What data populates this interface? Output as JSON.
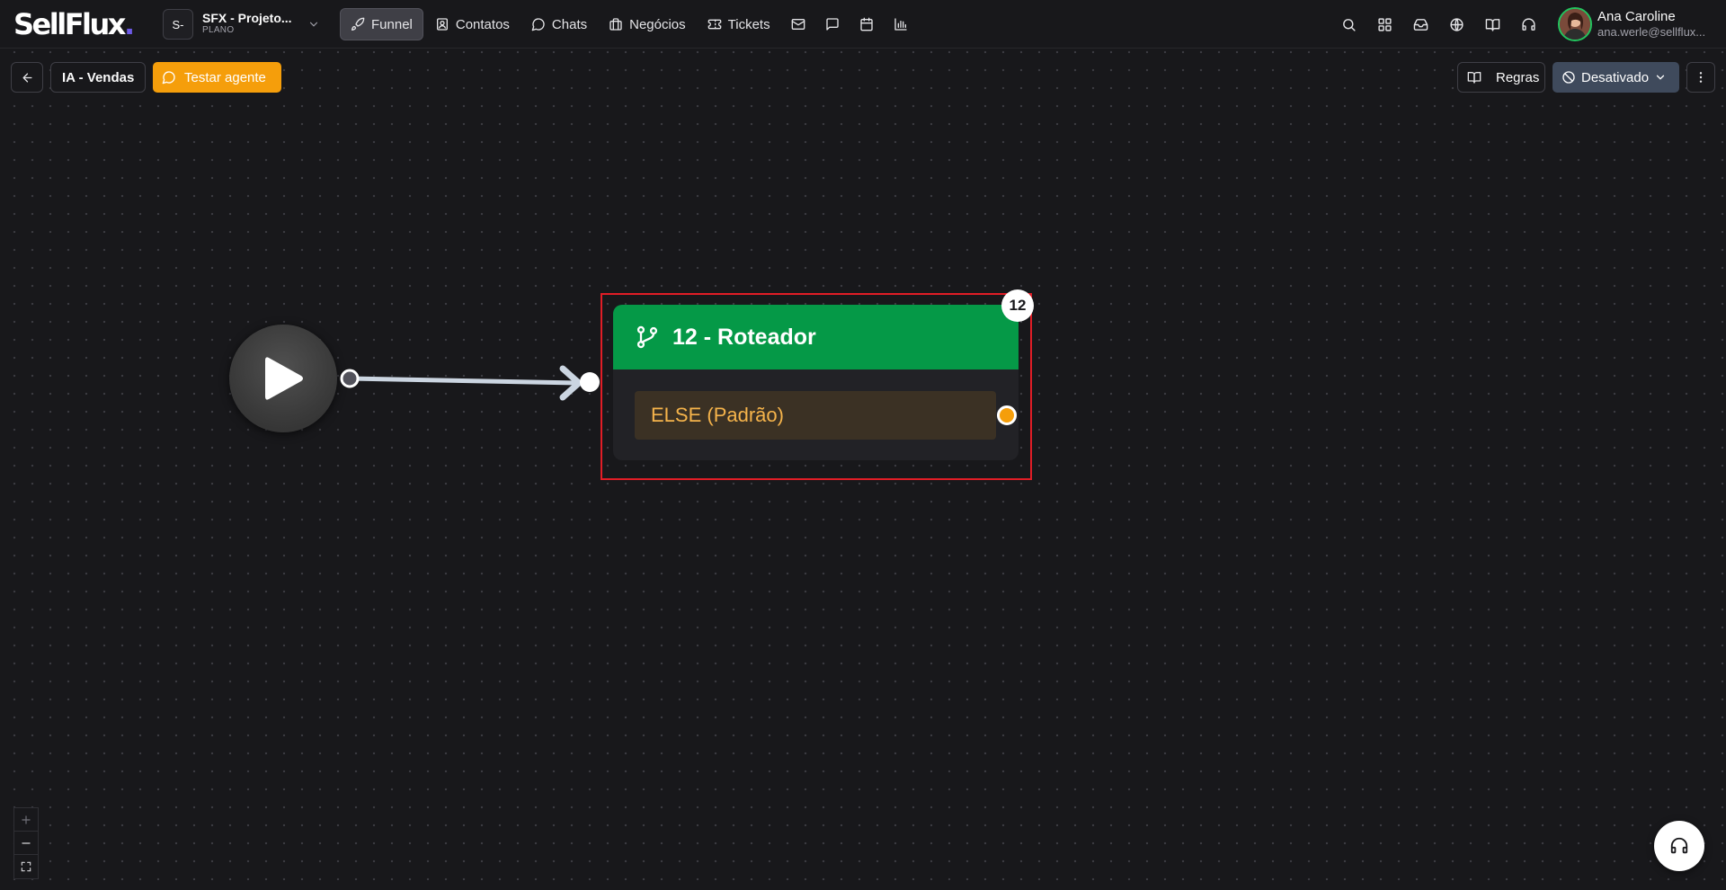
{
  "brand": {
    "logo_text": "SellFlux",
    "logo_dot": ".",
    "accent_color": "#6d5ae6"
  },
  "workspace": {
    "initials": "S-",
    "name": "SFX - Projeto...",
    "plan": "PLANO"
  },
  "nav": {
    "items": [
      {
        "label": "Funnel",
        "icon": "rocket-icon",
        "active": true
      },
      {
        "label": "Contatos",
        "icon": "contact-icon"
      },
      {
        "label": "Chats",
        "icon": "chat-bubble-icon"
      },
      {
        "label": "Negócios",
        "icon": "briefcase-icon"
      },
      {
        "label": "Tickets",
        "icon": "ticket-icon"
      }
    ],
    "icon_buttons": [
      "mail-icon",
      "message-square-icon",
      "calendar-icon",
      "bar-chart-icon"
    ]
  },
  "header_icons": [
    "search-icon",
    "grid-icon",
    "inbox-icon",
    "globe-icon",
    "book-icon",
    "headset-icon"
  ],
  "user": {
    "name": "Ana Caroline",
    "email": "ana.werle@sellflux..."
  },
  "toolbar": {
    "back_icon": "arrow-left-icon",
    "flow_name": "IA - Vendas",
    "test_label": "Testar agente",
    "test_color": "#f59e0b",
    "rules_label": "Regras",
    "status_label": "Desativado",
    "more_icon": "more-vertical-icon"
  },
  "canvas": {
    "start_node_icon": "play-icon",
    "router": {
      "title": "12 - Roteador",
      "icon": "git-branch-icon",
      "header_color": "#059947",
      "else_label": "ELSE (Padrão)",
      "badge": "12",
      "selected": true
    }
  },
  "controls": {
    "zoom_in": "plus-icon",
    "zoom_out": "minus-icon",
    "fit": "fullscreen-icon",
    "support": "headset-icon"
  }
}
